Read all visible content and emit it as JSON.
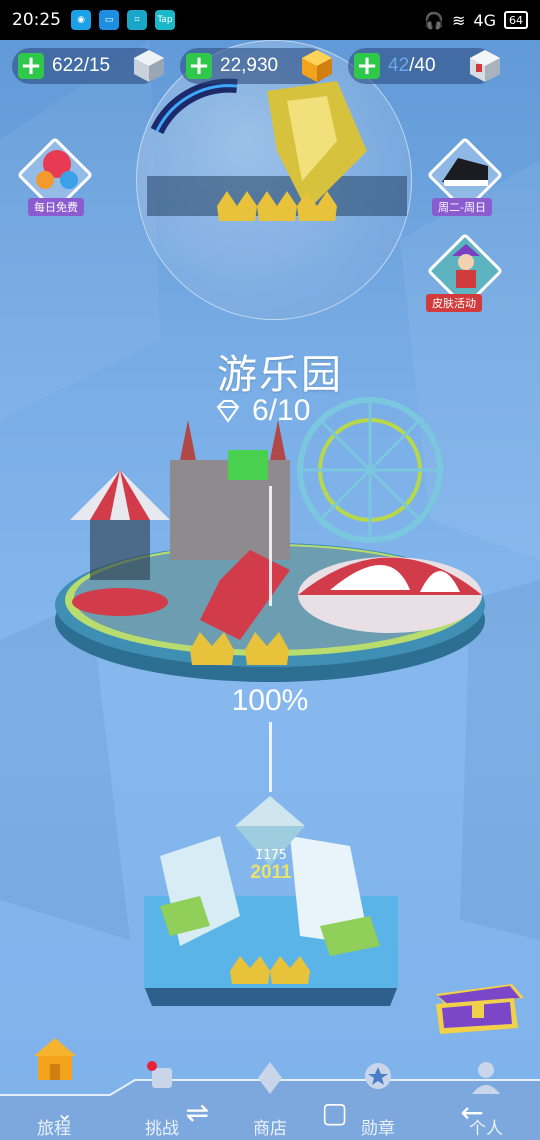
{
  "status_bar": {
    "time": "20:25",
    "network": "4G",
    "battery": "64"
  },
  "resources": [
    {
      "value": "622/15",
      "color": "#cfd6de"
    },
    {
      "value": "22,930",
      "color": "#f3a21e"
    },
    {
      "current": "42",
      "max": "/40",
      "color": "#d8dde3"
    }
  ],
  "side_buttons": {
    "daily_free": "每日免费",
    "weekday": "周二-周日",
    "skin_event": "皮肤活动"
  },
  "world": {
    "title": "游乐园",
    "gems": "6/10",
    "progress": "100%",
    "next_level_number": "I175",
    "next_level_year": "2011"
  },
  "nav": {
    "journey": "旅程",
    "challenge": "挑战",
    "shop": "商店",
    "medals": "勋章",
    "profile": "个人"
  },
  "colors": {
    "accent_green": "#2fc84a",
    "tag_purple": "#8a5cd0",
    "tag_red": "#d23b3b",
    "gold": "#e8c23a"
  }
}
